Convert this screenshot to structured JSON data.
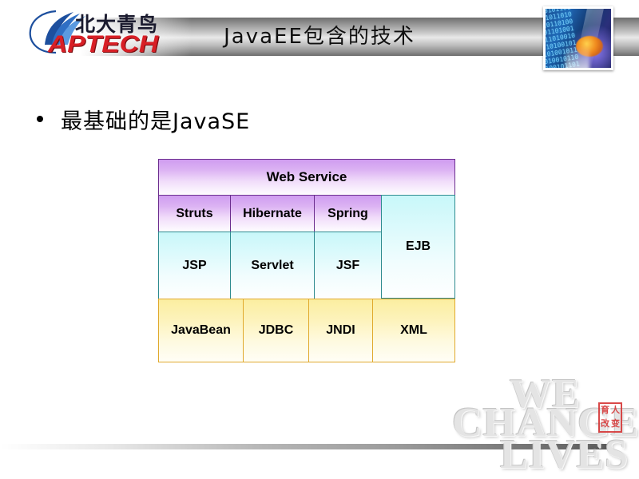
{
  "slide": {
    "title": "JavaEE包含的技术",
    "bullet": "最基础的是JavaSE"
  },
  "logo": {
    "chinese": "北大青鸟",
    "english": "APTECH",
    "swoosh_color": "#1d4f9e",
    "english_color": "#d81f26"
  },
  "thumbnail": {
    "binary_text": "01010110100101101001011010010110100101101001011010010110100101101001011010010110100101101001011010010110100101101001011010010110"
  },
  "table": {
    "banner": "Web Service",
    "frameworks": [
      "Struts",
      "Hibernate",
      "Spring"
    ],
    "web_tier": [
      "JSP",
      "Servlet",
      "JSF"
    ],
    "ejb": "EJB",
    "base": [
      "JavaBean",
      "JDBC",
      "JNDI",
      "XML"
    ],
    "colors": {
      "purple": "#cf9cf0",
      "purple_border": "#6b2d8e",
      "cyan": "#c8f7f9",
      "cyan_border": "#2e8b8f",
      "yellow": "#fbeea0",
      "yellow_border": "#e0a92c"
    }
  },
  "watermark": {
    "line1": "WE",
    "line2": "CHANGE",
    "line3": "LIVES",
    "seal": [
      "育",
      "人",
      "改",
      "变"
    ],
    "seal_color": "#d63a3a"
  }
}
